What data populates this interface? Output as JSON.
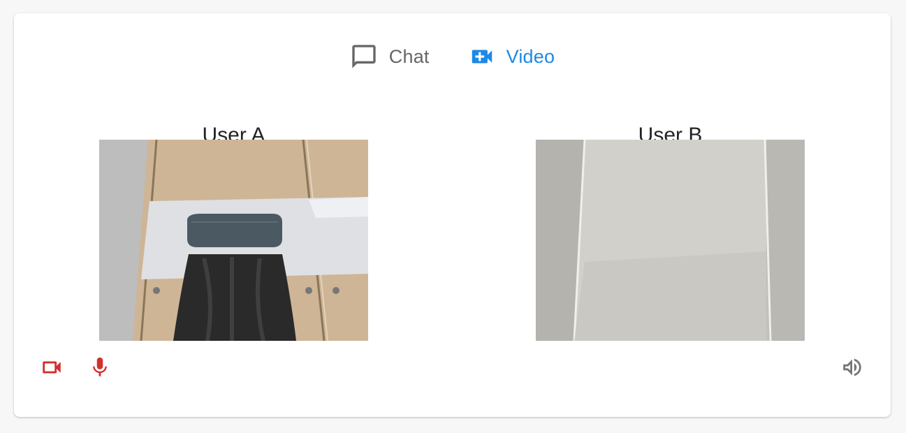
{
  "tabs": {
    "chat_label": "Chat",
    "video_label": "Video",
    "active": "video"
  },
  "participants": {
    "a": {
      "label": "User A"
    },
    "b": {
      "label": "User B"
    }
  },
  "controls": {
    "camera_icon": "videocam-icon",
    "mic_icon": "mic-icon",
    "volume_icon": "volume-icon"
  },
  "colors": {
    "accent": "#1e88e5",
    "inactive_tab": "#666666",
    "control_active": "#d32f2f",
    "volume": "#757575"
  }
}
